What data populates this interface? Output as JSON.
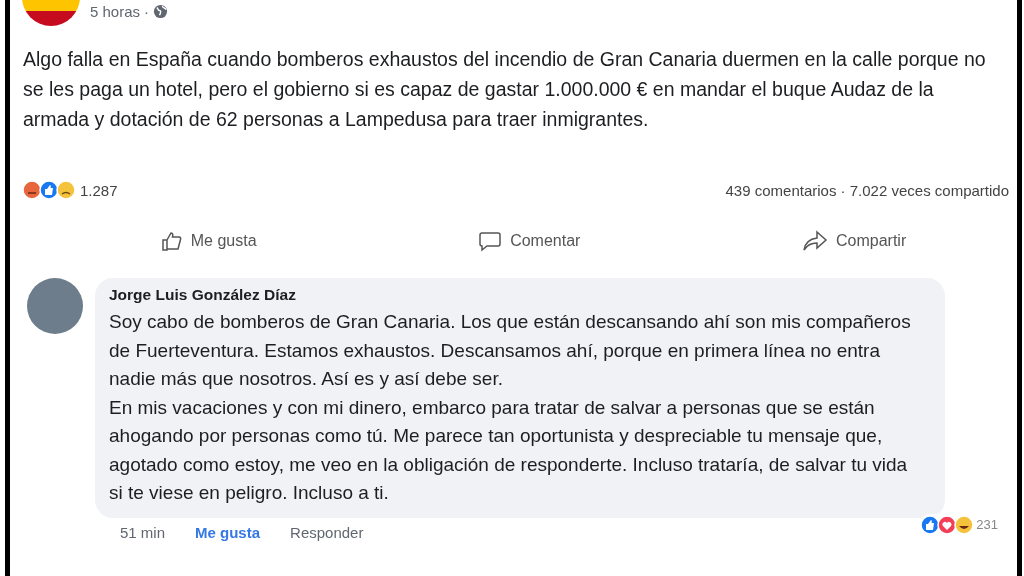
{
  "post": {
    "time": "5 horas",
    "separator": "·",
    "text": "Algo falla en España cuando bomberos exhaustos del incendio de Gran Canaria duermen en la calle porque no se les paga un hotel, pero el gobierno si es capaz de gastar 1.000.000 € en mandar el buque Audaz de la armada y dotación de 62 personas a Lampedusa para traer inmigrantes.",
    "reaction_count": "1.287",
    "stats": "439 comentarios · 7.022 veces compartido",
    "actions": [
      {
        "kind": "like",
        "label": "Me gusta"
      },
      {
        "kind": "comment",
        "label": "Comentar"
      },
      {
        "kind": "share",
        "label": "Compartir"
      }
    ]
  },
  "comment": {
    "author": "Jorge Luis González Díaz",
    "paragraphs": [
      "Soy cabo de bomberos de Gran Canaria. Los que están descansando ahí son mis compañeros de Fuerteventura. Estamos exhaustos. Descansamos ahí, porque en primera línea no entra nadie más que nosotros. Así es y así debe ser.",
      "En mis vacaciones y con mi dinero, embarco para tratar de salvar a personas que se están ahogando por personas como tú. Me parece tan oportunista y despreciable tu mensaje que, agotado como estoy, me veo en la obligación de responderte. Incluso trataría, de salvar tu vida si te viese en peligro. Incluso a ti."
    ],
    "time": "51 min",
    "like": "Me gusta",
    "reply": "Responder",
    "reaction_count": "231"
  }
}
